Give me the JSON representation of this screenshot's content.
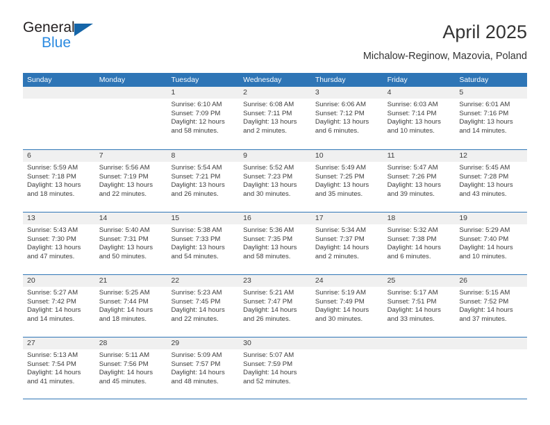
{
  "logo": {
    "word1": "General",
    "word2": "Blue",
    "triangle": "triangle-icon",
    "color_black": "#231f20",
    "color_blue": "#2b8ae0",
    "color_triangle": "#1565a8"
  },
  "header": {
    "title": "April 2025",
    "subtitle": "Michalow-Reginow, Mazovia, Poland"
  },
  "theme": {
    "header_bar": "#2e75b6",
    "row_divider": "#2e75b6",
    "date_strip": "#f0f0f0",
    "text": "#3b3b3b"
  },
  "calendar": {
    "weekday_headers": [
      "Sunday",
      "Monday",
      "Tuesday",
      "Wednesday",
      "Thursday",
      "Friday",
      "Saturday"
    ],
    "weeks": [
      [
        {
          "day": "",
          "sunrise": "",
          "sunset": "",
          "daylight1": "",
          "daylight2": ""
        },
        {
          "day": "",
          "sunrise": "",
          "sunset": "",
          "daylight1": "",
          "daylight2": ""
        },
        {
          "day": "1",
          "sunrise": "Sunrise: 6:10 AM",
          "sunset": "Sunset: 7:09 PM",
          "daylight1": "Daylight: 12 hours",
          "daylight2": "and 58 minutes."
        },
        {
          "day": "2",
          "sunrise": "Sunrise: 6:08 AM",
          "sunset": "Sunset: 7:11 PM",
          "daylight1": "Daylight: 13 hours",
          "daylight2": "and 2 minutes."
        },
        {
          "day": "3",
          "sunrise": "Sunrise: 6:06 AM",
          "sunset": "Sunset: 7:12 PM",
          "daylight1": "Daylight: 13 hours",
          "daylight2": "and 6 minutes."
        },
        {
          "day": "4",
          "sunrise": "Sunrise: 6:03 AM",
          "sunset": "Sunset: 7:14 PM",
          "daylight1": "Daylight: 13 hours",
          "daylight2": "and 10 minutes."
        },
        {
          "day": "5",
          "sunrise": "Sunrise: 6:01 AM",
          "sunset": "Sunset: 7:16 PM",
          "daylight1": "Daylight: 13 hours",
          "daylight2": "and 14 minutes."
        }
      ],
      [
        {
          "day": "6",
          "sunrise": "Sunrise: 5:59 AM",
          "sunset": "Sunset: 7:18 PM",
          "daylight1": "Daylight: 13 hours",
          "daylight2": "and 18 minutes."
        },
        {
          "day": "7",
          "sunrise": "Sunrise: 5:56 AM",
          "sunset": "Sunset: 7:19 PM",
          "daylight1": "Daylight: 13 hours",
          "daylight2": "and 22 minutes."
        },
        {
          "day": "8",
          "sunrise": "Sunrise: 5:54 AM",
          "sunset": "Sunset: 7:21 PM",
          "daylight1": "Daylight: 13 hours",
          "daylight2": "and 26 minutes."
        },
        {
          "day": "9",
          "sunrise": "Sunrise: 5:52 AM",
          "sunset": "Sunset: 7:23 PM",
          "daylight1": "Daylight: 13 hours",
          "daylight2": "and 30 minutes."
        },
        {
          "day": "10",
          "sunrise": "Sunrise: 5:49 AM",
          "sunset": "Sunset: 7:25 PM",
          "daylight1": "Daylight: 13 hours",
          "daylight2": "and 35 minutes."
        },
        {
          "day": "11",
          "sunrise": "Sunrise: 5:47 AM",
          "sunset": "Sunset: 7:26 PM",
          "daylight1": "Daylight: 13 hours",
          "daylight2": "and 39 minutes."
        },
        {
          "day": "12",
          "sunrise": "Sunrise: 5:45 AM",
          "sunset": "Sunset: 7:28 PM",
          "daylight1": "Daylight: 13 hours",
          "daylight2": "and 43 minutes."
        }
      ],
      [
        {
          "day": "13",
          "sunrise": "Sunrise: 5:43 AM",
          "sunset": "Sunset: 7:30 PM",
          "daylight1": "Daylight: 13 hours",
          "daylight2": "and 47 minutes."
        },
        {
          "day": "14",
          "sunrise": "Sunrise: 5:40 AM",
          "sunset": "Sunset: 7:31 PM",
          "daylight1": "Daylight: 13 hours",
          "daylight2": "and 50 minutes."
        },
        {
          "day": "15",
          "sunrise": "Sunrise: 5:38 AM",
          "sunset": "Sunset: 7:33 PM",
          "daylight1": "Daylight: 13 hours",
          "daylight2": "and 54 minutes."
        },
        {
          "day": "16",
          "sunrise": "Sunrise: 5:36 AM",
          "sunset": "Sunset: 7:35 PM",
          "daylight1": "Daylight: 13 hours",
          "daylight2": "and 58 minutes."
        },
        {
          "day": "17",
          "sunrise": "Sunrise: 5:34 AM",
          "sunset": "Sunset: 7:37 PM",
          "daylight1": "Daylight: 14 hours",
          "daylight2": "and 2 minutes."
        },
        {
          "day": "18",
          "sunrise": "Sunrise: 5:32 AM",
          "sunset": "Sunset: 7:38 PM",
          "daylight1": "Daylight: 14 hours",
          "daylight2": "and 6 minutes."
        },
        {
          "day": "19",
          "sunrise": "Sunrise: 5:29 AM",
          "sunset": "Sunset: 7:40 PM",
          "daylight1": "Daylight: 14 hours",
          "daylight2": "and 10 minutes."
        }
      ],
      [
        {
          "day": "20",
          "sunrise": "Sunrise: 5:27 AM",
          "sunset": "Sunset: 7:42 PM",
          "daylight1": "Daylight: 14 hours",
          "daylight2": "and 14 minutes."
        },
        {
          "day": "21",
          "sunrise": "Sunrise: 5:25 AM",
          "sunset": "Sunset: 7:44 PM",
          "daylight1": "Daylight: 14 hours",
          "daylight2": "and 18 minutes."
        },
        {
          "day": "22",
          "sunrise": "Sunrise: 5:23 AM",
          "sunset": "Sunset: 7:45 PM",
          "daylight1": "Daylight: 14 hours",
          "daylight2": "and 22 minutes."
        },
        {
          "day": "23",
          "sunrise": "Sunrise: 5:21 AM",
          "sunset": "Sunset: 7:47 PM",
          "daylight1": "Daylight: 14 hours",
          "daylight2": "and 26 minutes."
        },
        {
          "day": "24",
          "sunrise": "Sunrise: 5:19 AM",
          "sunset": "Sunset: 7:49 PM",
          "daylight1": "Daylight: 14 hours",
          "daylight2": "and 30 minutes."
        },
        {
          "day": "25",
          "sunrise": "Sunrise: 5:17 AM",
          "sunset": "Sunset: 7:51 PM",
          "daylight1": "Daylight: 14 hours",
          "daylight2": "and 33 minutes."
        },
        {
          "day": "26",
          "sunrise": "Sunrise: 5:15 AM",
          "sunset": "Sunset: 7:52 PM",
          "daylight1": "Daylight: 14 hours",
          "daylight2": "and 37 minutes."
        }
      ],
      [
        {
          "day": "27",
          "sunrise": "Sunrise: 5:13 AM",
          "sunset": "Sunset: 7:54 PM",
          "daylight1": "Daylight: 14 hours",
          "daylight2": "and 41 minutes."
        },
        {
          "day": "28",
          "sunrise": "Sunrise: 5:11 AM",
          "sunset": "Sunset: 7:56 PM",
          "daylight1": "Daylight: 14 hours",
          "daylight2": "and 45 minutes."
        },
        {
          "day": "29",
          "sunrise": "Sunrise: 5:09 AM",
          "sunset": "Sunset: 7:57 PM",
          "daylight1": "Daylight: 14 hours",
          "daylight2": "and 48 minutes."
        },
        {
          "day": "30",
          "sunrise": "Sunrise: 5:07 AM",
          "sunset": "Sunset: 7:59 PM",
          "daylight1": "Daylight: 14 hours",
          "daylight2": "and 52 minutes."
        },
        {
          "day": "",
          "sunrise": "",
          "sunset": "",
          "daylight1": "",
          "daylight2": ""
        },
        {
          "day": "",
          "sunrise": "",
          "sunset": "",
          "daylight1": "",
          "daylight2": ""
        },
        {
          "day": "",
          "sunrise": "",
          "sunset": "",
          "daylight1": "",
          "daylight2": ""
        }
      ]
    ]
  }
}
